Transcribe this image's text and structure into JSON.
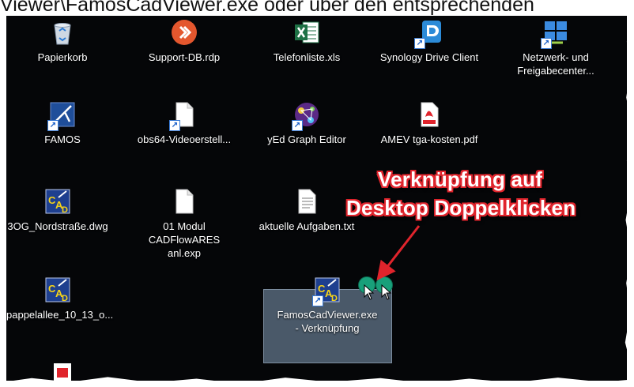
{
  "caption": "Viewer\\FamosCadViewer.exe oder über den entsprechenden",
  "icons": [
    {
      "label": "Papierkorb",
      "icon": "recycle-bin-icon"
    },
    {
      "label": "Support-DB.rdp",
      "icon": "remote-desktop-icon"
    },
    {
      "label": "Telefonliste.xls",
      "icon": "excel-icon"
    },
    {
      "label": "Synology Drive Client",
      "icon": "synology-drive-icon"
    },
    {
      "label": "Netzwerk- und\nFreigabecenter...",
      "icon": "network-center-icon"
    },
    {
      "label": "FAMOS",
      "icon": "famos-icon"
    },
    {
      "label": "obs64-Videoerstell...",
      "icon": "file-icon"
    },
    {
      "label": "yEd Graph Editor",
      "icon": "yed-icon"
    },
    {
      "label": "AMEV tga-kosten.pdf",
      "icon": "pdf-icon"
    },
    {
      "label": "3OG_Nordstraße.dwg",
      "icon": "cad-icon"
    },
    {
      "label": "01 Modul\nCADFlowARES anl.exp",
      "icon": "file-icon"
    },
    {
      "label": "aktuelle Aufgaben.txt",
      "icon": "text-file-icon"
    },
    {
      "label": "pappelallee_10_13_o...",
      "icon": "cad-icon"
    },
    {
      "label": "FamosCadViewer.exe\n- Verknüpfung",
      "icon": "cad-icon"
    }
  ],
  "annotation": {
    "line1": "Verknüpfung auf",
    "line2": "Desktop Doppelklicken",
    "color": "#e0242c"
  }
}
